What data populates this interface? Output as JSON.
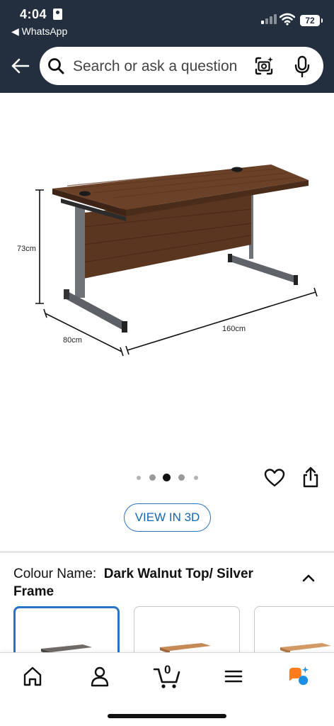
{
  "status_bar": {
    "time": "4:04",
    "back_app": "◀ WhatsApp",
    "battery": "72"
  },
  "search": {
    "placeholder": "Search or ask a question"
  },
  "product_image": {
    "dimensions": {
      "height": "73cm",
      "depth": "80cm",
      "width": "160cm"
    },
    "carousel_total": 5,
    "carousel_active": 3
  },
  "actions": {
    "view_3d": "VIEW IN 3D"
  },
  "variation": {
    "label": "Colour Name:",
    "value": "Dark Walnut Top/ Silver Frame"
  },
  "bottom_nav": {
    "items": [
      "home",
      "account",
      "cart",
      "menu",
      "rufus"
    ],
    "cart_count": "0"
  },
  "colors": {
    "header_bg": "#232f3e",
    "accent_blue": "#2a72c4",
    "walnut": "#5a3520",
    "frame_silver": "#6f7378"
  }
}
